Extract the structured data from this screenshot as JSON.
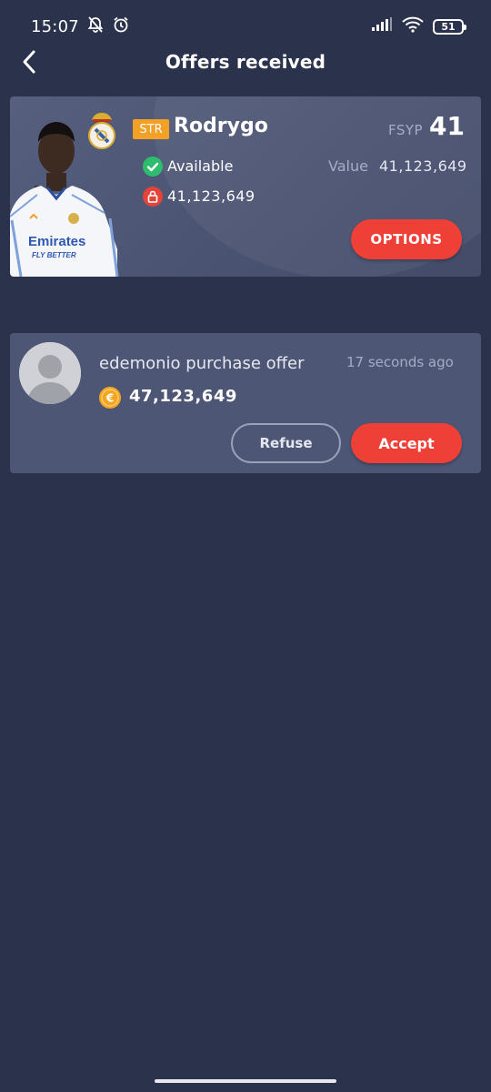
{
  "status_bar": {
    "time": "15:07",
    "icons": [
      "bell-off-icon",
      "alarm-icon",
      "signal-icon",
      "wifi-icon",
      "battery-icon"
    ],
    "battery_level": "51"
  },
  "header": {
    "title": "Offers received",
    "back_icon": "chevron-left-icon"
  },
  "player": {
    "position": "STR",
    "name": "Rodrygo",
    "fsyp_label": "FSYP",
    "fsyp_value": "41",
    "status": "Available",
    "value_label": "Value",
    "value_amount": "41,123,649",
    "clause_amount": "41,123,649",
    "options_label": "OPTIONS",
    "shirt_sponsor": "Emirates",
    "shirt_tagline": "FLY BETTER"
  },
  "offer": {
    "title": "edemonio purchase offer",
    "time": "17 seconds ago",
    "currency_symbol": "€",
    "amount": "47,123,649",
    "refuse_label": "Refuse",
    "accept_label": "Accept"
  },
  "colors": {
    "background": "#2b324b",
    "card": "#4d5674",
    "accent": "#ee4036",
    "position_badge": "#f2a126",
    "available": "#2ebd6e",
    "coin": "#f4a623"
  }
}
